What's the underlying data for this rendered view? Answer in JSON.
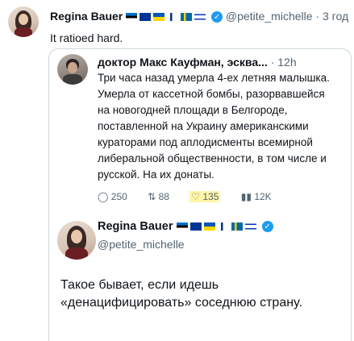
{
  "header": {
    "name": "Regina Bauer",
    "handle": "@petite_michelle",
    "separator": "·",
    "time": "3 год",
    "text": "It ratioed hard."
  },
  "quoted": {
    "name": "доктор Макс Кауфман, эсква...",
    "separator": "·",
    "time": "12h",
    "text": "Три часа назад умерла 4-ех летняя малышка. Умерла от кассетной бомбы, разорвавшейся на новогодней площади в Белгороде, поставленной на Украину американскими кураторами под аплодисменты всемирной либеральной общественности, в том числе и русской. На их донаты.",
    "actions": {
      "replies": "250",
      "retweets": "88",
      "likes": "135",
      "views": "12K"
    }
  },
  "reply": {
    "name": "Regina Bauer",
    "handle": "@petite_michelle",
    "text": "Такое бывает, если идешь «денацифицировать» соседнюю страну."
  },
  "colors": {
    "accent": "#1d9bf0",
    "like_highlight": "#fff6a8",
    "muted": "#536471"
  },
  "icons": [
    "flag-estonia-icon",
    "flag-eu-icon",
    "flag-ukraine-icon",
    "flag-finland-icon",
    "flag-sweden-icon",
    "flag-israel-icon",
    "verified-icon",
    "reply-icon",
    "retweet-icon",
    "heart-icon",
    "views-icon"
  ]
}
